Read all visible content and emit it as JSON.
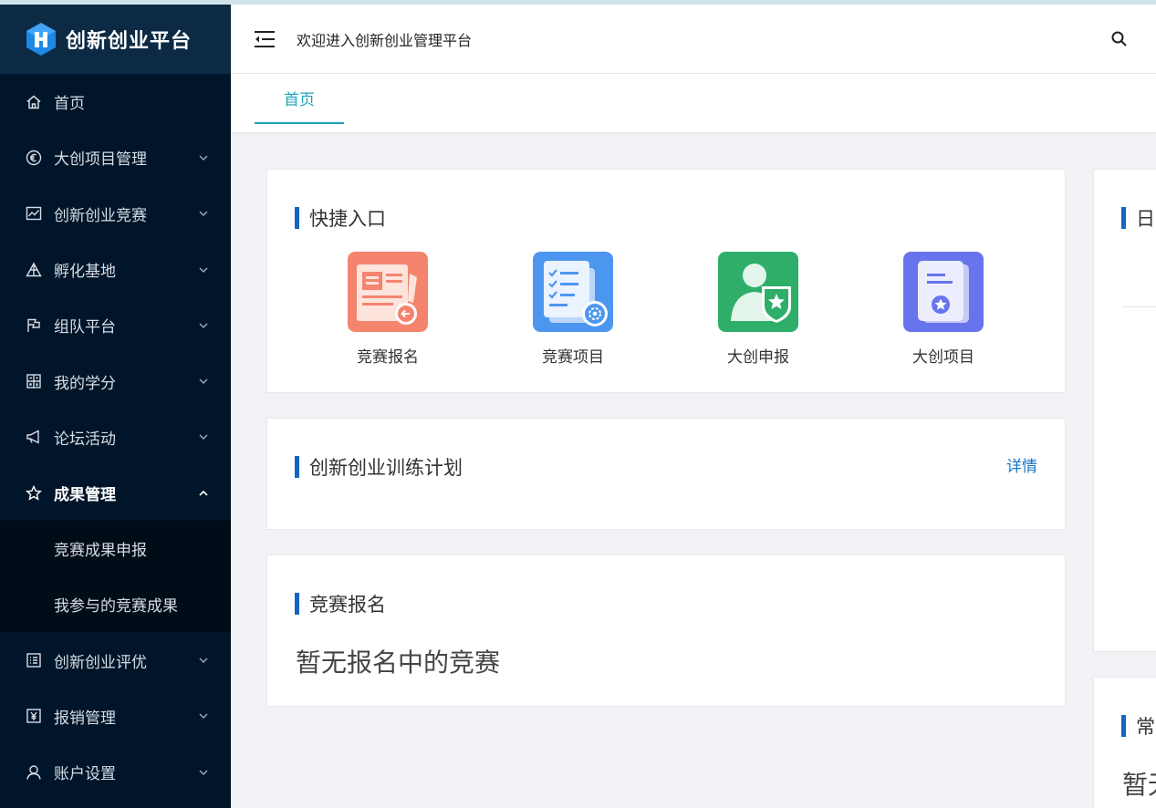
{
  "app": {
    "brand_title": "创新创业平台",
    "welcome_text": "欢迎进入创新创业管理平台"
  },
  "colors": {
    "sidebar_bg": "#001529",
    "accent": "#1aa3b8",
    "title_bar": "#1565c0",
    "link": "#1677c7"
  },
  "sidebar": {
    "items": [
      {
        "label": "首页",
        "icon": "home-icon"
      },
      {
        "label": "大创项目管理",
        "icon": "euro-circle-icon"
      },
      {
        "label": "创新创业竞赛",
        "icon": "line-chart-icon"
      },
      {
        "label": "孵化基地",
        "icon": "pyramid-icon"
      },
      {
        "label": "组队平台",
        "icon": "flag-icon"
      },
      {
        "label": "我的学分",
        "icon": "calculator-icon"
      },
      {
        "label": "论坛活动",
        "icon": "megaphone-icon"
      },
      {
        "label": "成果管理",
        "icon": "star-icon",
        "expanded": true
      },
      {
        "label": "创新创业评优",
        "icon": "list-icon"
      },
      {
        "label": "报销管理",
        "icon": "yen-icon"
      },
      {
        "label": "账户设置",
        "icon": "user-icon"
      }
    ],
    "submenu_results": [
      {
        "label": "竞赛成果申报"
      },
      {
        "label": "我参与的竞赛成果"
      }
    ]
  },
  "tabs": [
    {
      "label": "首页",
      "active": true
    }
  ],
  "quick_entry": {
    "title": "快捷入口",
    "items": [
      {
        "label": "竞赛报名",
        "icon": "competition-signup-icon",
        "color": "#f4846e"
      },
      {
        "label": "竞赛项目",
        "icon": "competition-project-icon",
        "color": "#4d96f0"
      },
      {
        "label": "大创申报",
        "icon": "dachuang-apply-icon",
        "color": "#2fae6a"
      },
      {
        "label": "大创项目",
        "icon": "dachuang-project-icon",
        "color": "#6874ec"
      }
    ]
  },
  "training_plan": {
    "title": "创新创业训练计划",
    "detail_label": "详情"
  },
  "competition_signup": {
    "title": "竞赛报名",
    "empty_text": "暂无报名中的竞赛"
  },
  "right_panel": {
    "card1_title": "日",
    "card2_title": "常",
    "card2_text": "暂无"
  }
}
